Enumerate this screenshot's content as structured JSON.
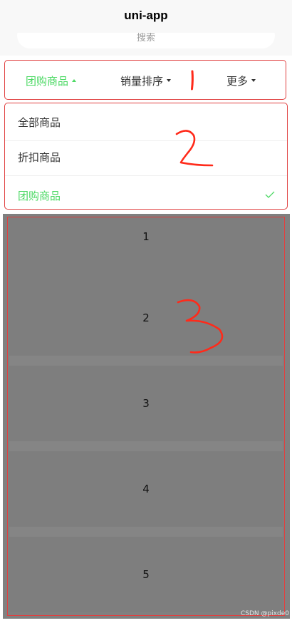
{
  "navbar": {
    "title": "uni-app"
  },
  "search": {
    "placeholder": "搜索"
  },
  "filter_tabs": [
    {
      "label": "团购商品",
      "active": true
    },
    {
      "label": "销量排序",
      "active": false
    },
    {
      "label": "更多",
      "active": false
    }
  ],
  "dropdown": {
    "options": [
      {
        "label": "全部商品",
        "selected": false
      },
      {
        "label": "折扣商品",
        "selected": false
      },
      {
        "label": "团购商品",
        "selected": true
      }
    ]
  },
  "list": {
    "items": [
      "1",
      "2",
      "3",
      "4",
      "5"
    ]
  },
  "annotations": [
    "1",
    "2",
    "3"
  ],
  "watermark": "CSDN @pixde0",
  "colors": {
    "accent": "#4cd964",
    "annotation": "#e04040",
    "mask": "#808080",
    "text": "#333333"
  },
  "icons": {
    "check": "check-icon",
    "arrow_up": "caret-up-icon",
    "arrow_down": "caret-down-icon"
  }
}
